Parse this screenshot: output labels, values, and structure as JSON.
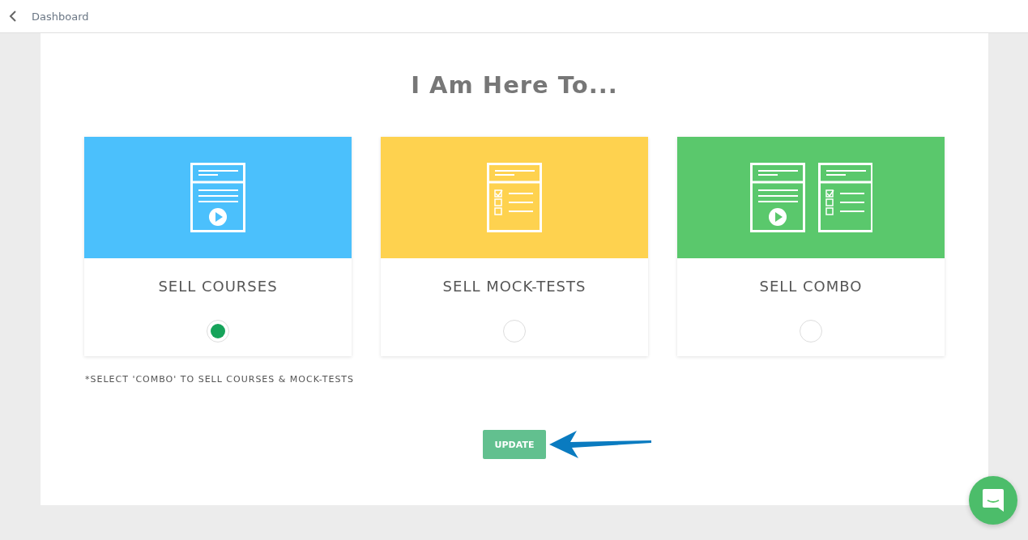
{
  "header": {
    "back_label": "Dashboard"
  },
  "title": "I Am Here To...",
  "options": [
    {
      "kind": "course",
      "label": "SELL COURSES",
      "color": "#4bc0fc",
      "selected": true
    },
    {
      "kind": "mocktest",
      "label": "SELL MOCK-TESTS",
      "color": "#fed24f",
      "selected": false
    },
    {
      "kind": "combo",
      "label": "SELL COMBO",
      "color": "#5ac86c",
      "selected": false
    }
  ],
  "note": "*SELECT 'COMBO' TO SELL COURSES & MOCK-TESTS",
  "button": "UPDATE"
}
